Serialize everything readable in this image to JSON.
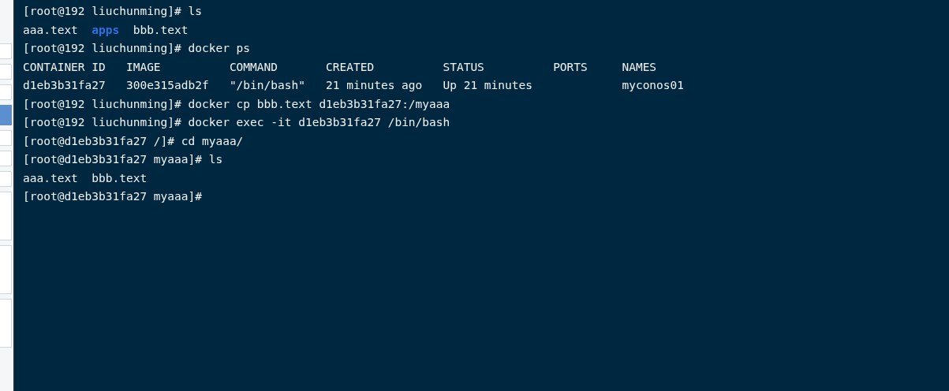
{
  "terminal": {
    "lines": [
      {
        "kind": "prompt",
        "prompt": "[root@192 liuchunming]#",
        "command": "ls"
      },
      {
        "kind": "listing",
        "entries": [
          {
            "name": "aaa.text",
            "kind": "file"
          },
          {
            "name": "apps",
            "kind": "dir"
          },
          {
            "name": "bbb.text",
            "kind": "file"
          }
        ]
      },
      {
        "kind": "prompt",
        "prompt": "[root@192 liuchunming]#",
        "command": "docker ps"
      },
      {
        "kind": "table",
        "columns": [
          "CONTAINER ID",
          "IMAGE",
          "COMMAND",
          "CREATED",
          "STATUS",
          "PORTS",
          "NAMES"
        ],
        "rows": [
          [
            "d1eb3b31fa27",
            "300e315adb2f",
            "\"/bin/bash\"",
            "21 minutes ago",
            "Up 21 minutes",
            null,
            "myconos01"
          ]
        ]
      },
      {
        "kind": "prompt",
        "prompt": "[root@192 liuchunming]#",
        "command": "docker cp bbb.text d1eb3b31fa27:/myaaa"
      },
      {
        "kind": "prompt",
        "prompt": "[root@192 liuchunming]#",
        "command": "docker exec -it d1eb3b31fa27 /bin/bash"
      },
      {
        "kind": "prompt",
        "prompt": "[root@d1eb3b31fa27 /]#",
        "command": "cd myaaa/"
      },
      {
        "kind": "prompt",
        "prompt": "[root@d1eb3b31fa27 myaaa]#",
        "command": "ls"
      },
      {
        "kind": "listing",
        "entries": [
          {
            "name": "aaa.text",
            "kind": "file"
          },
          {
            "name": "bbb.text",
            "kind": "file"
          }
        ]
      },
      {
        "kind": "prompt",
        "prompt": "[root@d1eb3b31fa27 myaaa]#"
      }
    ]
  }
}
